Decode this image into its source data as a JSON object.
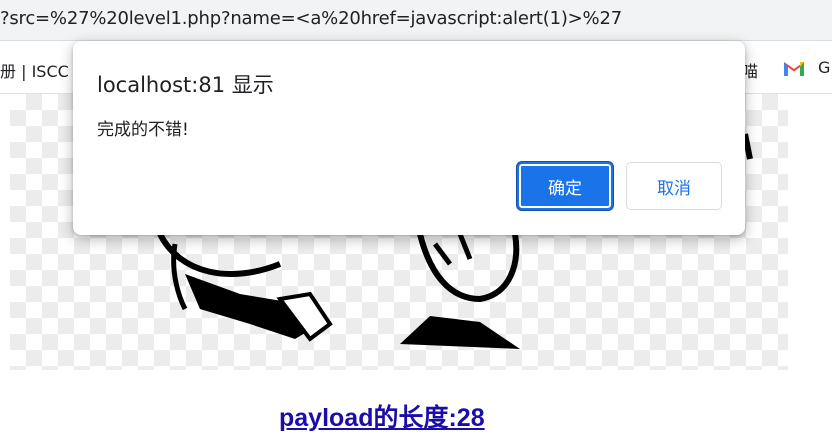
{
  "browser": {
    "url": "?src=%27%20level1.php?name=<a%20href=javascript:alert(1)>%27"
  },
  "bookmarks": {
    "left_partial": "册 | ISCC",
    "right_partial": "喵",
    "gmail_icon": "gmail-icon",
    "trailing_partial": "G"
  },
  "page": {
    "payload_link": "payload的长度:28"
  },
  "dialog": {
    "title": "localhost:81 显示",
    "message": "完成的不错!",
    "ok_label": "确定",
    "cancel_label": "取消"
  },
  "colors": {
    "accent": "#1a73e8",
    "link": "#1a0dab",
    "text": "#202124"
  }
}
